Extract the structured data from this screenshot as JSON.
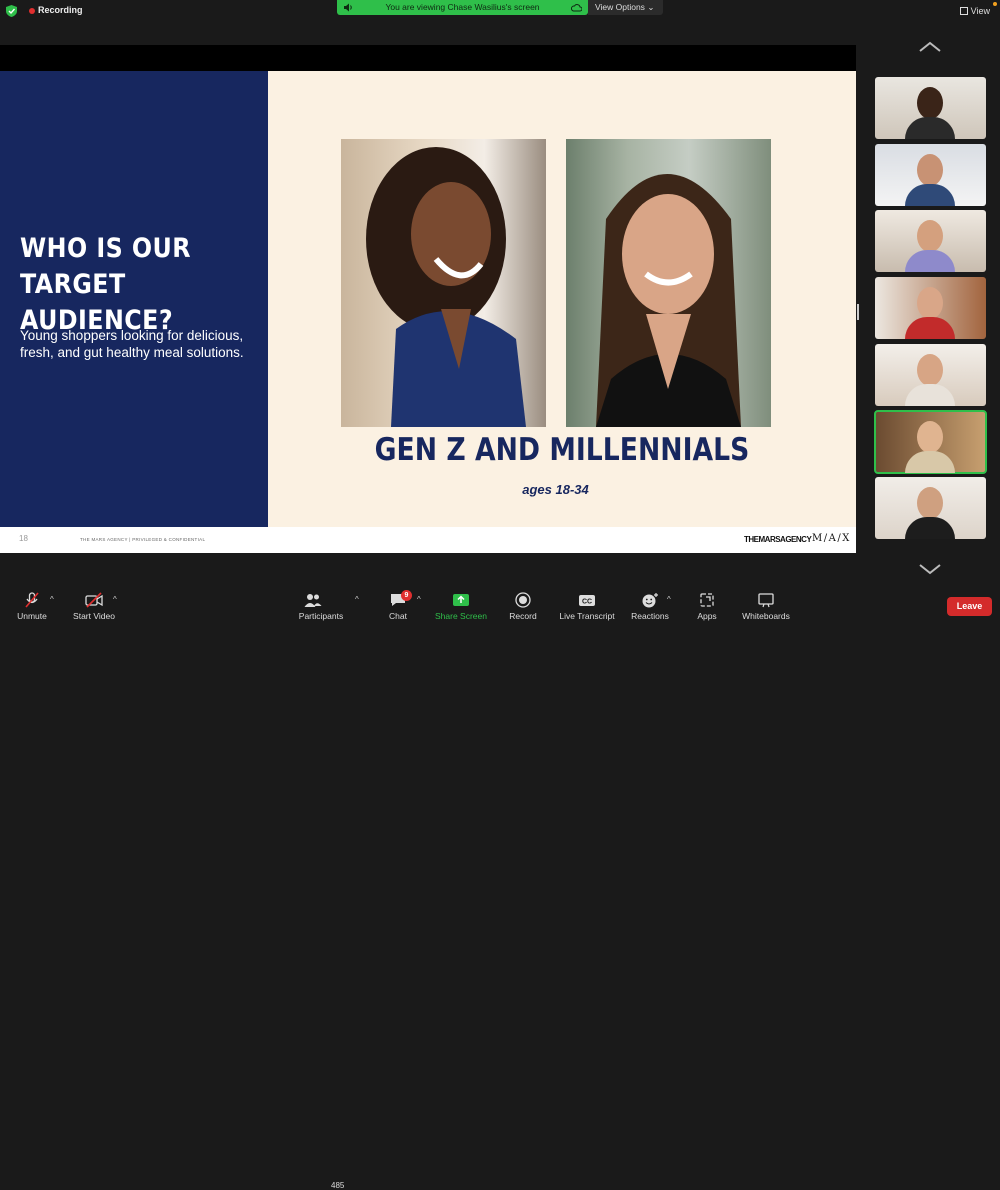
{
  "top_bar": {
    "recording_label": "Recording",
    "viewing_text": "You are viewing Chase Wasilius's screen",
    "view_options_label": "View Options",
    "view_label": "View"
  },
  "slide": {
    "title": "WHO IS OUR TARGET AUDIENCE?",
    "subtitle": "Young shoppers looking for delicious, fresh, and gut healthy meal solutions.",
    "heading": "GEN Z AND MILLENNIALS",
    "ages": "ages 18-34",
    "page_number": "18",
    "footer_note": "THE MARS AGENCY  |  PRIVILEGED & CONFIDENTIAL",
    "logo_text": "THEMARSAGENCY",
    "logo_text_2": "M/A/X",
    "colors": {
      "navy": "#17275f",
      "cream": "#fbf1e2"
    }
  },
  "gallery": {
    "active_index": 5,
    "participant_count": 7
  },
  "toolbar": {
    "unmute_label": "Unmute",
    "start_video_label": "Start Video",
    "participants_label": "Participants",
    "participants_count": "485",
    "chat_label": "Chat",
    "chat_badge": "9",
    "share_screen_label": "Share Screen",
    "record_label": "Record",
    "live_transcript_label": "Live Transcript",
    "reactions_label": "Reactions",
    "apps_label": "Apps",
    "whiteboards_label": "Whiteboards",
    "leave_label": "Leave",
    "accent_green": "#2fbf4a",
    "leave_red": "#d42b2b"
  }
}
